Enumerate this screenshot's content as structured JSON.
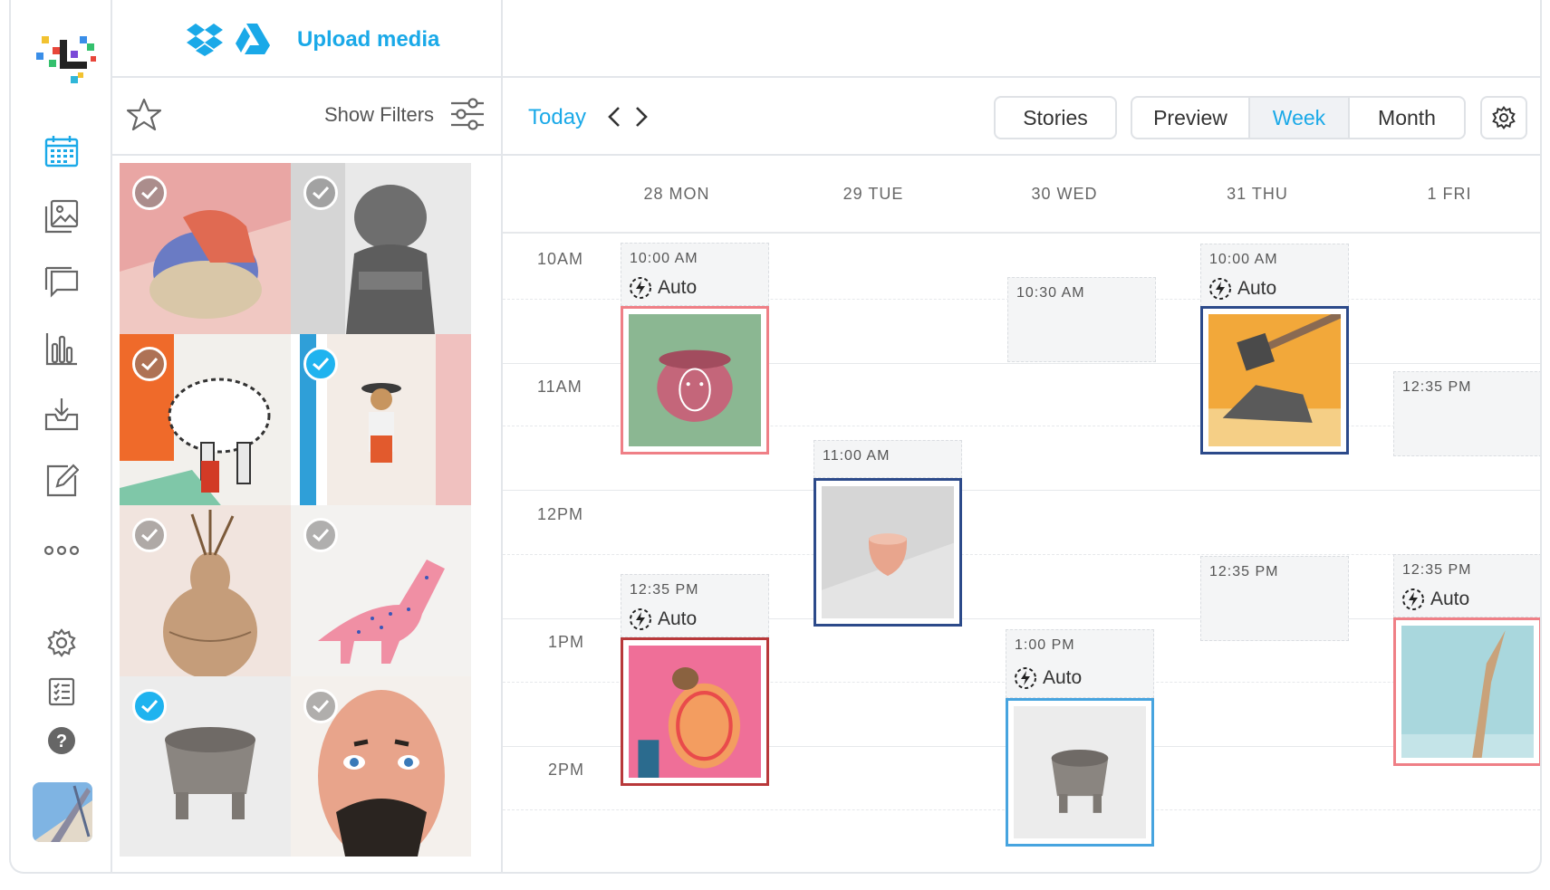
{
  "colors": {
    "accent": "#1aa9e8",
    "pink_border": "#ef7f86",
    "navy_border": "#2c4a8a",
    "light_blue_border": "#47a4df",
    "red_border": "#b8383a"
  },
  "sidebar": {
    "items": [
      {
        "icon": "calendar-icon"
      },
      {
        "icon": "gallery-icon"
      },
      {
        "icon": "chat-icon"
      },
      {
        "icon": "analytics-icon"
      },
      {
        "icon": "inbox-icon"
      },
      {
        "icon": "edit-icon"
      },
      {
        "icon": "more-icon"
      },
      {
        "icon": "gear-icon"
      },
      {
        "icon": "checklist-icon"
      },
      {
        "icon": "help-icon"
      }
    ]
  },
  "media": {
    "upload_label": "Upload media",
    "show_filters": "Show Filters",
    "tiles": [
      {
        "name": "hand-sculpture",
        "checked": false
      },
      {
        "name": "stone-statue",
        "checked": false
      },
      {
        "name": "alebrije-dog",
        "checked": false
      },
      {
        "name": "cowboy-figure",
        "checked": true
      },
      {
        "name": "gourd-vase",
        "checked": false
      },
      {
        "name": "pink-dinosaur",
        "checked": false
      },
      {
        "name": "stone-mortar",
        "checked": true
      },
      {
        "name": "painted-mask",
        "checked": false
      }
    ]
  },
  "toolbar": {
    "today": "Today",
    "stories": "Stories",
    "preview": "Preview",
    "week": "Week",
    "month": "Month"
  },
  "calendar": {
    "days": [
      "28 MON",
      "29 TUE",
      "30 WED",
      "31 THU",
      "1 FRI"
    ],
    "hours": [
      "10AM",
      "11AM",
      "12PM",
      "1PM",
      "2PM"
    ],
    "auto_label": "Auto",
    "slots": {
      "mon_1": "10:00 AM",
      "mon_2": "12:35 PM",
      "tue_1": "11:00 AM",
      "wed_1": "10:30 AM",
      "wed_2": "1:00 PM",
      "thu_1": "10:00 AM",
      "thu_2": "12:35 PM",
      "fri_1": "12:35 PM",
      "fri_2": "12:35 PM"
    }
  }
}
